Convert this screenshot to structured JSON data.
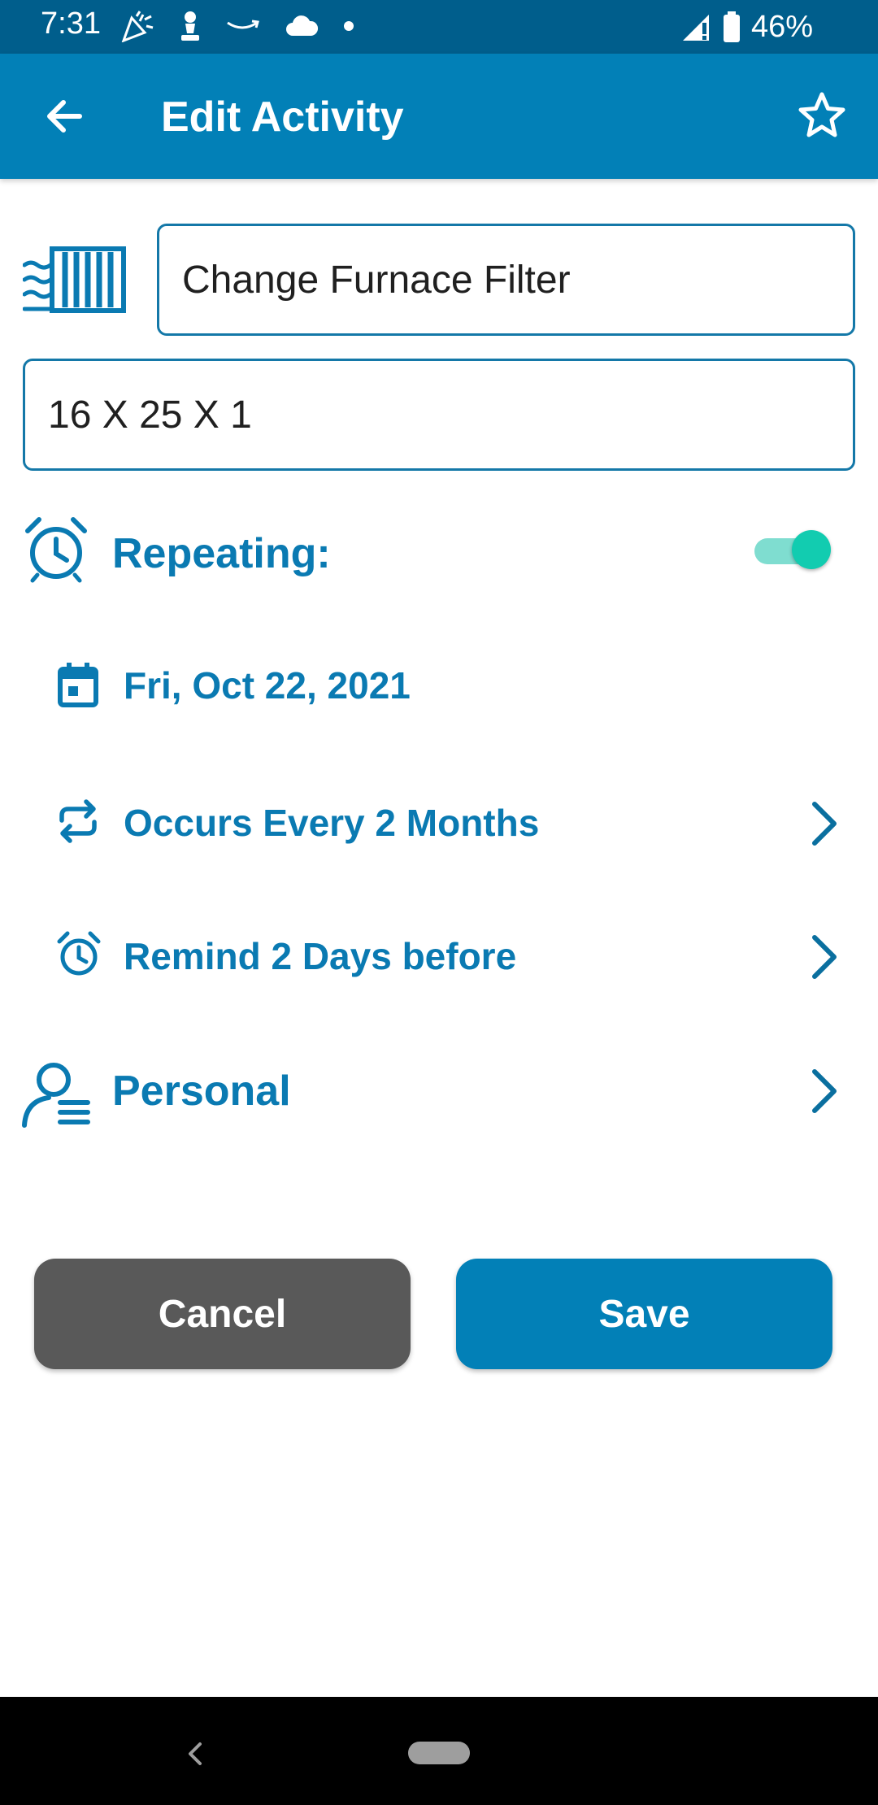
{
  "status_bar": {
    "time": "7:31",
    "battery": "46%",
    "icons": [
      "party-popper-icon",
      "chess-pawn-icon",
      "amazon-smile-icon",
      "cloud-icon",
      "dot-icon",
      "signal-icon",
      "battery-icon"
    ]
  },
  "app_bar": {
    "title": "Edit Activity",
    "back_icon": "arrow-back-icon",
    "favorite_icon": "star-outline-icon"
  },
  "activity": {
    "icon": "furnace-filter-icon",
    "name_value": "Change Furnace Filter",
    "description_value": "16 X 25 X 1"
  },
  "repeating": {
    "label": "Repeating:",
    "enabled": true,
    "icon": "alarm-clock-icon"
  },
  "schedule": {
    "date_label": "Fri, Oct 22, 2021",
    "recurrence_label": "Occurs Every 2 Months",
    "reminder_label": "Remind 2 Days before"
  },
  "category": {
    "label": "Personal",
    "icon": "person-list-icon"
  },
  "buttons": {
    "cancel_label": "Cancel",
    "save_label": "Save"
  },
  "colors": {
    "status_bar": "#005e8c",
    "app_bar": "#0280b7",
    "accent_text": "#0a7ab2",
    "toggle_on": "#12ccb0",
    "cancel_button": "#595959",
    "save_button": "#0280b7"
  }
}
